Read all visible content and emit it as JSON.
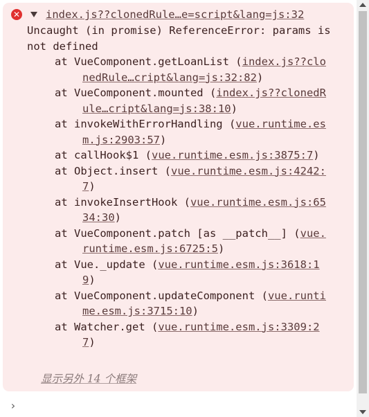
{
  "error": {
    "header_link": "index.js??clonedRule…e=script&lang=js:32",
    "message": "Uncaught (in promise) ReferenceError: params is not defined",
    "frames": [
      {
        "at": "at VueComponent.getLoanList (",
        "link": "index.js??clonedRule…cript&lang=js:32:82",
        "close": ")"
      },
      {
        "at": "at VueComponent.mounted (",
        "link": "index.js??clonedRule…cript&lang=js:38:10",
        "close": ")"
      },
      {
        "at": "at invokeWithErrorHandling (",
        "link": "vue.runtime.esm.js:2903:57",
        "close": ")"
      },
      {
        "at": "at callHook$1 (",
        "link": "vue.runtime.esm.js:3875:7",
        "close": ")"
      },
      {
        "at": "at Object.insert (",
        "link": "vue.runtime.esm.js:4242:7",
        "close": ")"
      },
      {
        "at": "at invokeInsertHook (",
        "link": "vue.runtime.esm.js:6534:30",
        "close": ")"
      },
      {
        "at": "at VueComponent.patch [as __patch__] (",
        "link": "vue.runtime.esm.js:6725:5",
        "close": ")"
      },
      {
        "at": "at Vue._update (",
        "link": "vue.runtime.esm.js:3618:19",
        "close": ")"
      },
      {
        "at": "at VueComponent.updateComponent (",
        "link": "vue.runtime.esm.js:3715:10",
        "close": ")"
      },
      {
        "at": "at Watcher.get (",
        "link": "vue.runtime.esm.js:3309:27",
        "close": ")"
      }
    ],
    "show_more": "显示另外 14 个框架"
  },
  "prompt_symbol": "›",
  "icons": {
    "error": "error-circle-icon",
    "expand": "triangle-down-icon"
  },
  "colors": {
    "error_bg": "#fcebeb",
    "error_icon": "#e0302f",
    "text": "#3a1f1f"
  }
}
